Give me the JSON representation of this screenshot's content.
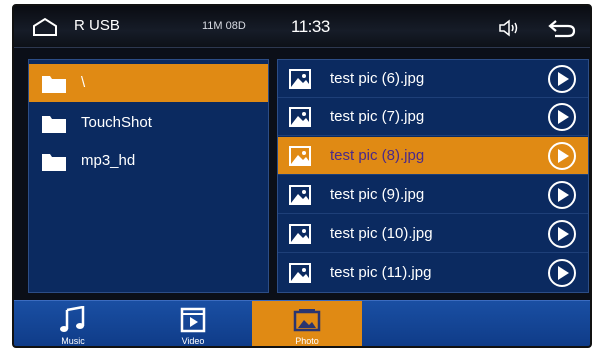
{
  "statusbar": {
    "source": "R USB",
    "info": "11M 08D",
    "time": "11:33",
    "home_icon": "home-icon",
    "volume_icon": "speaker-icon",
    "back_icon": "back-arrow-icon"
  },
  "folders": [
    {
      "label": "\\",
      "selected": true
    },
    {
      "label": "TouchShot",
      "selected": false
    },
    {
      "label": "mp3_hd",
      "selected": false
    }
  ],
  "files": [
    {
      "label": "test pic (6).jpg",
      "selected": false
    },
    {
      "label": "test pic (7).jpg",
      "selected": false
    },
    {
      "label": "test pic (8).jpg",
      "selected": true
    },
    {
      "label": "test pic (9).jpg",
      "selected": false
    },
    {
      "label": "test pic (10).jpg",
      "selected": false
    },
    {
      "label": "test pic (11).jpg",
      "selected": false
    }
  ],
  "dock": {
    "music": "Music",
    "video": "Video",
    "photo": "Photo",
    "active": "photo"
  },
  "colors": {
    "panel": "#0b2a60",
    "highlight": "#e08a14",
    "dock": "#1a4fa3",
    "selected_text": "#4a2a8a"
  }
}
